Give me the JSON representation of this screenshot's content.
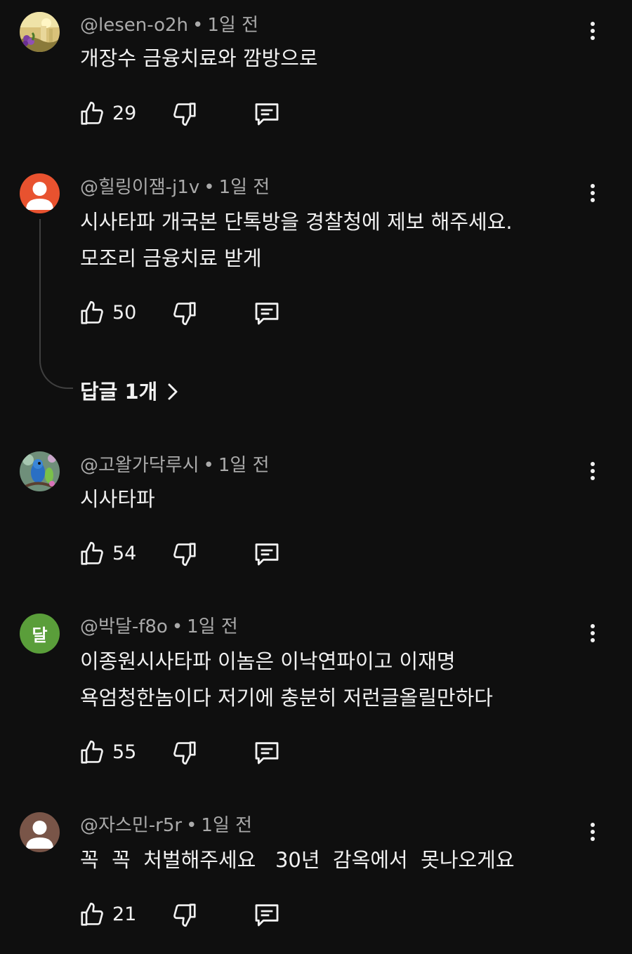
{
  "comments": [
    {
      "handle": "@lesen-o2h",
      "time": "1일 전",
      "lines": [
        "개장수 금융치료와 깜방으로"
      ],
      "likes": "29",
      "avatar": "landscape-avatar-icon"
    },
    {
      "handle": "@힐링이잼-j1v",
      "time": "1일 전",
      "lines": [
        "시사타파 개국본 단톡방을 경찰청에 제보 해주세요.",
        "모조리 금융치료 받게"
      ],
      "likes": "50",
      "avatar": "default-person-avatar-icon",
      "avatar_color": "#e8522f",
      "replies_label": "답글 1개"
    },
    {
      "handle": "@고왈가닥루시",
      "time": "1일 전",
      "lines": [
        "시사타파"
      ],
      "likes": "54",
      "avatar": "parrot-avatar-icon"
    },
    {
      "handle": "@박달-f8o",
      "time": "1일 전",
      "lines": [
        "이종원시사타파 이놈은 이낙연파이고 이재명",
        "욕엄청한놈이다 저기에 충분히 저런글올릴만하다"
      ],
      "likes": "55",
      "avatar_letter": "달",
      "avatar_color": "#5a9e3a"
    },
    {
      "handle": "@자스민-r5r",
      "time": "1일 전",
      "lines": [
        "꼭  꼭  처벌해주세요   30년  감옥에서  못나오게요"
      ],
      "likes": "21",
      "avatar": "default-person-avatar-icon",
      "avatar_color": "#795548"
    }
  ],
  "separator": "•",
  "colors": {
    "background": "#0f0f0f",
    "text": "#f1f1f1",
    "meta_text": "#aaaaaa",
    "thread_line": "#3f3f3f"
  }
}
